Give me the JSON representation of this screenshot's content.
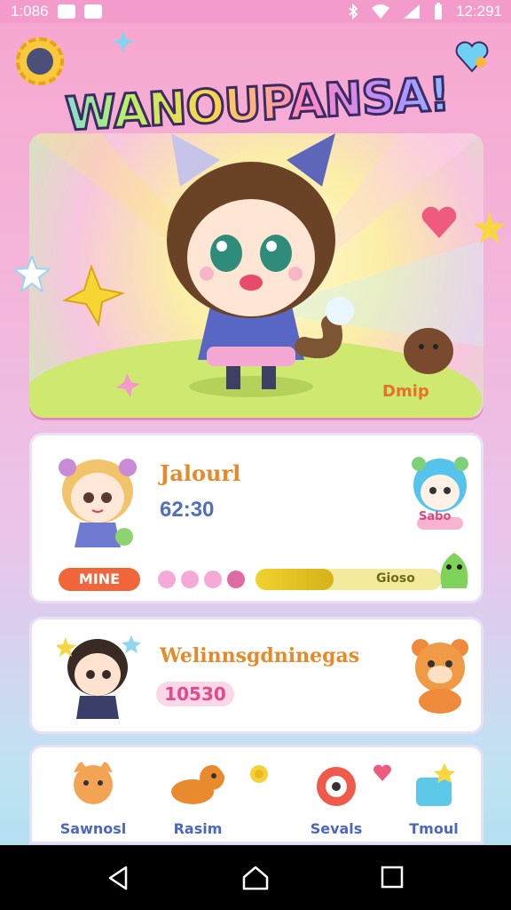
{
  "status_bar": {
    "time_left": "1:086",
    "time_right": "12:291"
  },
  "header": {
    "title": "WANOUPANSA!"
  },
  "hero": {
    "corner_label": "Dmip"
  },
  "player_card": {
    "name": "Jalourl",
    "score": "62:30",
    "mode_button": "MINE",
    "progress_dots": 4,
    "xp_fraction": 0.42,
    "xp_label": "Gioso",
    "badge_label": "Sabo"
  },
  "card2": {
    "title": "Welinnsgdninegas",
    "score": "10530"
  },
  "bottom_nav": [
    {
      "label": "Sawnosl",
      "color": "#f2a354"
    },
    {
      "label": "Rasim",
      "color": "#e98a2f"
    },
    {
      "label": "Sevals",
      "color": "#ef5a4a"
    },
    {
      "label": "Tmoul",
      "color": "#5cc9e8"
    }
  ],
  "colors": {
    "accent_pink": "#f39ccb",
    "mine_button": "#f0653a",
    "score_blue": "#4f6fbf"
  }
}
